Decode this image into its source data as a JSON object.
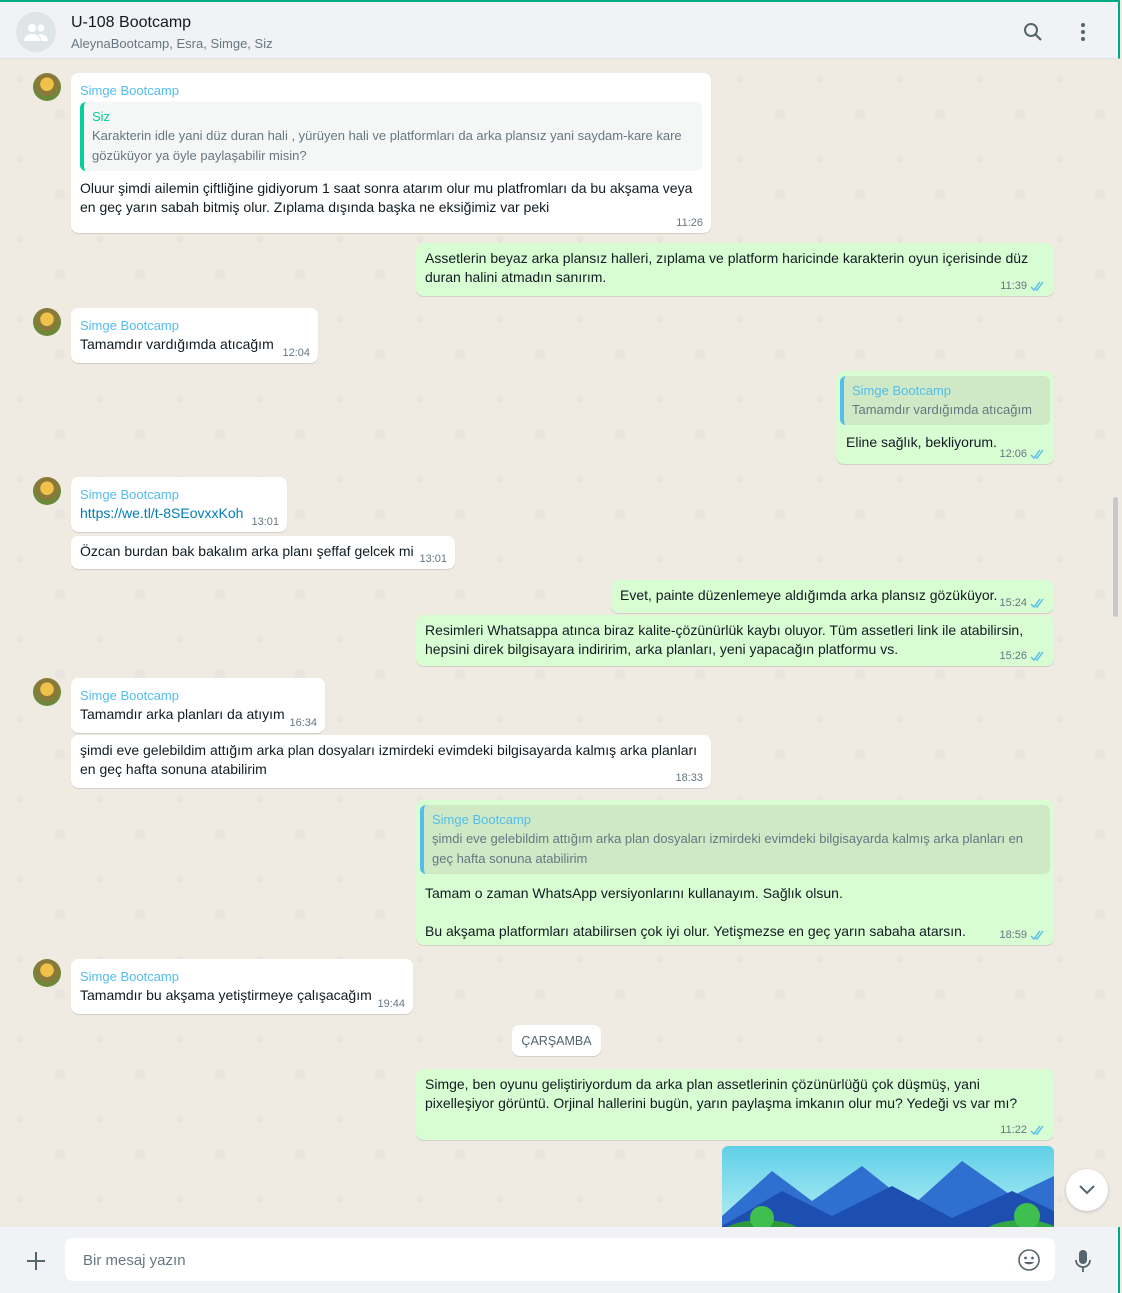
{
  "header": {
    "title": "U-108 Bootcamp",
    "participants": "AleynaBootcamp, Esra, Simge, Siz"
  },
  "messages": [
    {
      "sender": "Simge Bootcamp",
      "quote_name": "Siz",
      "quote_text": "Karakterin idle yani düz duran hali , yürüyen hali ve platformları da arka plansız yani saydam-kare kare gözüküyor ya öyle paylaşabilir misin?",
      "text": "Oluur şimdi ailemin çiftliğine gidiyorum 1 saat sonra atarım olur mu platfromları da bu akşama veya en geç yarın sabah bitmiş olur. Zıplama dışında başka ne eksiğimiz var peki",
      "time": "11:26"
    },
    {
      "text": "Assetlerin beyaz arka plansız halleri, zıplama ve platform haricinde karakterin oyun içerisinde düz duran halini atmadın sanırım.",
      "time": "11:39"
    },
    {
      "sender": "Simge Bootcamp",
      "text": "Tamamdır vardığımda atıcağım",
      "time": "12:04"
    },
    {
      "quote_name": "Simge Bootcamp",
      "quote_text": "Tamamdır vardığımda atıcağım",
      "text": "Eline sağlık, bekliyorum.",
      "time": "12:06"
    },
    {
      "sender": "Simge Bootcamp",
      "text": "https://we.tl/t-8SEovxxKoh",
      "time": "13:01"
    },
    {
      "text": "Özcan burdan bak bakalım arka planı şeffaf gelcek mi",
      "time": "13:01"
    },
    {
      "text": "Evet, painte düzenlemeye aldığımda arka plansız gözüküyor.",
      "time": "15:24"
    },
    {
      "text": "Resimleri Whatsappa atınca biraz kalite-çözünürlük kaybı oluyor. Tüm assetleri link ile atabilirsin, hepsini direk bilgisayara indiririm, arka planları, yeni yapacağın platformu vs.",
      "time": "15:26"
    },
    {
      "sender": "Simge Bootcamp",
      "text": "Tamamdır arka planları da atıyım",
      "time": "16:34"
    },
    {
      "text": "şimdi eve gelebildim attığım arka plan dosyaları izmirdeki evimdeki bilgisayarda kalmış arka planları en geç hafta sonuna atabilirim",
      "time": "18:33"
    },
    {
      "quote_name": "Simge Bootcamp",
      "quote_text": "şimdi eve gelebildim attığım arka plan dosyaları izmirdeki evimdeki bilgisayarda kalmış arka planları en geç hafta sonuna atabilirim",
      "text1": "Tamam o zaman WhatsApp versiyonlarını kullanayım. Sağlık olsun.",
      "text2": "Bu akşama platformları atabilirsen çok iyi olur. Yetişmezse en geç yarın sabaha atarsın.",
      "time": "18:59"
    },
    {
      "sender": "Simge Bootcamp",
      "text": "Tamamdır bu akşama yetiştirmeye çalışacağım",
      "time": "19:44"
    },
    {
      "text": "Simge, ben oyunu geliştiriyordum da arka plan assetlerinin çözünürlüğü çok düşmüş, yani pixelleşiyor görüntü. Orjinal hallerini bugün, yarın paylaşma imkanın olur mu? Yedeği vs var mı?",
      "time": "11:22"
    }
  ],
  "date_divider": "ÇARŞAMBA",
  "composer": {
    "placeholder": "Bir mesaj yazın"
  },
  "colors": {
    "outgoing_bubble": "#d9fdd3",
    "incoming_bubble": "#ffffff",
    "sender_name": "#53bdeb",
    "read_tick": "#53bdeb",
    "accent": "#00a884"
  }
}
